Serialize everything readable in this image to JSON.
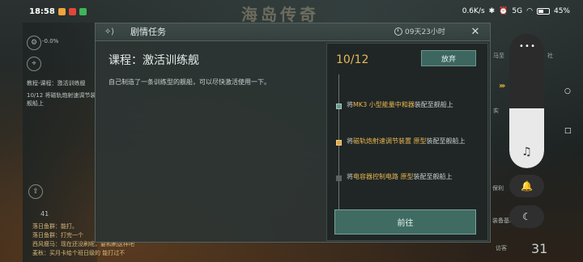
{
  "status_bar": {
    "time": "18:58",
    "network_speed": "0.6K/s",
    "signal": "5G",
    "battery_percent": "45%",
    "battery_level": 0.45
  },
  "background": {
    "game_title": "海岛传奇",
    "left_texts": [
      "-0.0%",
      "教程-课程：激活训练舰",
      "10/12 将磁轨炮射速调节装",
      "舰船上"
    ],
    "chat_count": "41",
    "chat_lines": [
      "落日鱼群：能打。",
      "落日鱼群：打完一个",
      "西风瘦马：现在还没刷呢，要和刷这样吧",
      "麦秋：买月卡给个班日级的  能打过不"
    ],
    "right_labels": [
      "马至",
      "社",
      "实",
      "保险箱",
      "保利",
      "保护",
      "装备",
      "装备基地",
      "访客"
    ],
    "right_number": "31"
  },
  "dialog": {
    "header_title": "剧情任务",
    "timer": "09天23小时",
    "close_icon": "✕",
    "course_title": "课程：激活训练舰",
    "course_description": "自己制造了一条训练型的舰船，可以尽快激活使用一下。"
  },
  "task_panel": {
    "progress": "10/12",
    "abandon_label": "放弃",
    "steps": [
      {
        "prefix": "将",
        "item": "MK3 小型能量中和器",
        "suffix": "装配至舰船上",
        "state": "done"
      },
      {
        "prefix": "将",
        "item": "磁轨炮射速调节装置 原型",
        "suffix": "装配至舰船上",
        "state": "active"
      },
      {
        "prefix": "将",
        "item": "电容器控制电路 原型",
        "suffix": "装配至舰船上",
        "state": "todo"
      }
    ],
    "go_label": "前往"
  },
  "side_controls": {
    "volume_level": 0.45,
    "music_icon": "♫",
    "bell_icon": "🔔",
    "moon_icon": "☾",
    "nav_icons": [
      "○",
      "□"
    ]
  }
}
